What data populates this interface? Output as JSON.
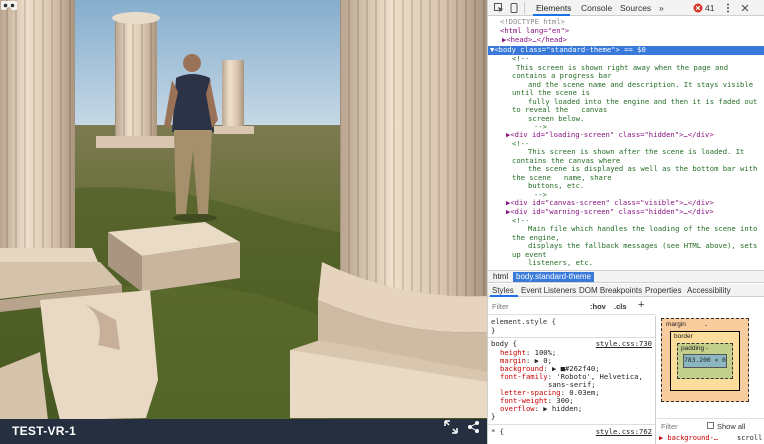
{
  "scene": {
    "name": "TEST-VR-1",
    "colors": {
      "sky": "#a9c9e0",
      "ground": "#5d6a2c",
      "bar": "#262f40",
      "column": "#e3cfb7"
    }
  },
  "devtools": {
    "tabs": [
      "Elements",
      "Console",
      "Sources",
      "»"
    ],
    "error_count": "41",
    "dom_lines": [
      "<!DOCTYPE html>",
      "<html lang=\"en\">",
      "▶<head>…</head>",
      "▼<body class=\"standard-theme\"> == $0",
      "<!--",
      "This screen is shown right away when the page and",
      "contains a progress bar",
      "and the scene name and description. It stays visible",
      "until the scene is",
      "fully loaded into the engine and then it is faded out",
      "to reveal the   canvas",
      "screen below.",
      "-->",
      "▶<div id=\"loading-screen\" class=\"hidden\">…</div>",
      "<!--",
      "This screen is shown after the scene is loaded. It",
      "contains the canvas where",
      "the scene is displayed as well as the bottom bar with",
      "the scene   name, share",
      "buttons, etc.",
      "-->",
      "▶<div id=\"canvas-screen\" class=\"visible\">…</div>",
      "▶<div id=\"warning-screen\" class=\"hidden\">…</div>",
      "<!--",
      "Main file which handles the loading of the scene into",
      "the engine,",
      "displays the fallback messages (see HTML above), sets",
      "up event",
      "listeners, etc.",
      "-->"
    ],
    "breadcrumbs": [
      "html",
      "body.standard-theme"
    ],
    "sub_tabs": [
      "Styles",
      "Event Listeners",
      "DOM Breakpoints",
      "Properties",
      "Accessibility"
    ],
    "filter_placeholder": "Filter",
    "filter_buttons": [
      ":hov",
      ".cls",
      "+"
    ],
    "element_style": "element.style {",
    "element_style_close": "}",
    "body_rule": {
      "selector": "body {",
      "source": "style.css:730",
      "props": [
        {
          "name": "height",
          "value": "100%;"
        },
        {
          "name": "margin",
          "value": "▶ 0;"
        },
        {
          "name": "background",
          "value": "▶ ■#262f40;"
        },
        {
          "name": "font-family",
          "value": "'Roboto', Helvetica,"
        },
        {
          "name": "",
          "value": "sans-serif;"
        },
        {
          "name": "letter-spacing",
          "value": "0.03em;"
        },
        {
          "name": "font-weight",
          "value": "300;"
        },
        {
          "name": "overflow",
          "value": "▶ hidden;"
        }
      ],
      "close": "}"
    },
    "next_rule": {
      "selector": "* {",
      "source": "style.css:762"
    },
    "box_model": {
      "margin_label": "margin",
      "border_label": "border",
      "padding_label": "padding -",
      "content": "783.200 × 0",
      "dash": "-"
    },
    "computed_filter": "Filter",
    "show_all": "Show all",
    "computed_prop": "▶ background-…",
    "computed_val": "scroll"
  }
}
